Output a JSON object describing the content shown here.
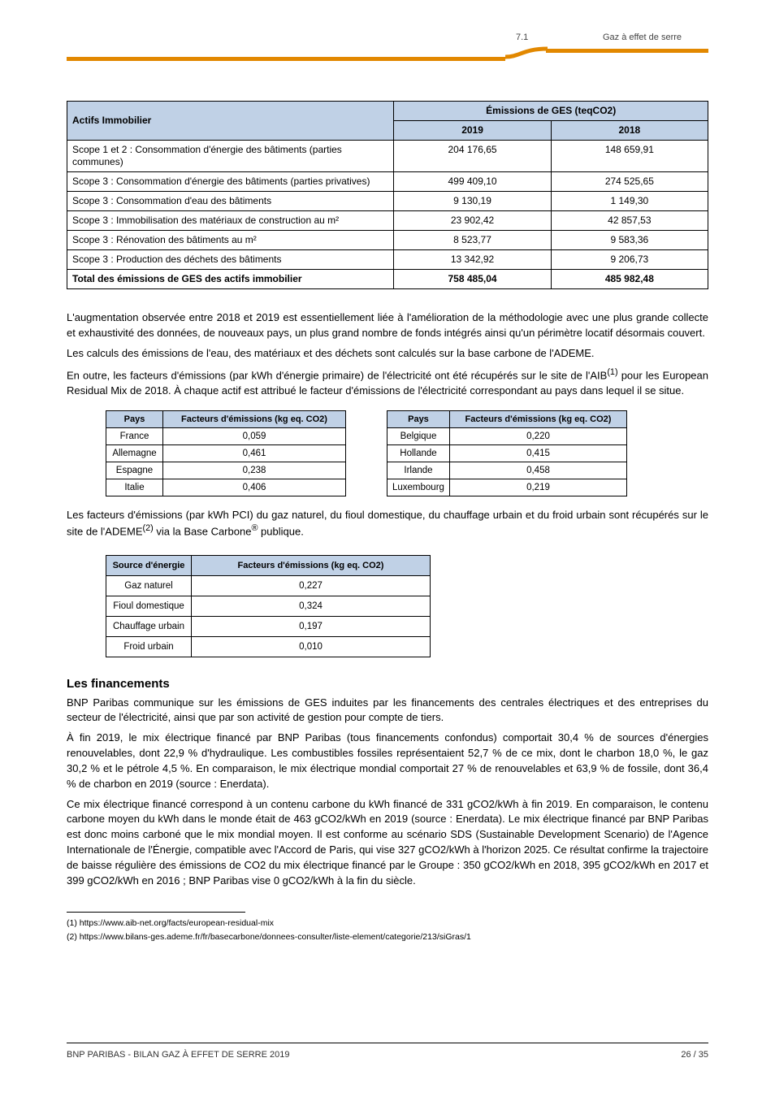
{
  "header": {
    "left": "7.1 ",
    "right": "Gaz à effet de serre"
  },
  "chart_data": [
    {
      "type": "table",
      "title": "Émissions de GES — Actifs Immobilier",
      "header": {
        "actifs": "Actifs Immobilier",
        "emissions": "Émissions de GES (teqCO2)",
        "y2019": "2019",
        "y2018": "2018"
      },
      "rows": [
        {
          "label": "Scope 1 et 2 : Consommation d'énergie des bâtiments (parties communes)",
          "y2019": "204 176,65",
          "y2018": "148 659,91"
        },
        {
          "label": "Scope 3 : Consommation d'énergie des bâtiments (parties privatives)",
          "y2019": "499 409,10",
          "y2018": "274 525,65"
        },
        {
          "label": "Scope 3 : Consommation d'eau des bâtiments",
          "y2019": "9 130,19",
          "y2018": "1 149,30"
        },
        {
          "label": "Scope 3 : Immobilisation des matériaux de construction au m²",
          "y2019": "23 902,42",
          "y2018": "42 857,53"
        },
        {
          "label": "Scope 3 : Rénovation des bâtiments au m²",
          "y2019": "8 523,77",
          "y2018": "9 583,36"
        },
        {
          "label": "Scope 3 : Production des déchets des bâtiments",
          "y2019": "13 342,92",
          "y2018": "9 206,73"
        },
        {
          "label": "Total des émissions de GES des actifs immobilier",
          "bold": true,
          "y2019": "758 485,04",
          "y2018": "485 982,48"
        }
      ]
    },
    {
      "type": "table",
      "title": "Facteurs d'émissions par pays (kg eq. CO2)",
      "groups": [
        {
          "header": {
            "c1": "Pays",
            "c2": "Facteurs d'émissions (kg eq. CO2)"
          },
          "rows": [
            {
              "c1": "France",
              "c2": "0,059"
            },
            {
              "c1": "Allemagne",
              "c2": "0,461"
            },
            {
              "c1": "Espagne",
              "c2": "0,238"
            },
            {
              "c1": "Italie",
              "c2": "0,406"
            }
          ]
        },
        {
          "header": {
            "c1": "Pays",
            "c2": "Facteurs d'émissions (kg eq. CO2)"
          },
          "rows": [
            {
              "c1": "Belgique",
              "c2": "0,220"
            },
            {
              "c1": "Hollande",
              "c2": "0,415"
            },
            {
              "c1": "Irlande",
              "c2": "0,458"
            },
            {
              "c1": "Luxembourg",
              "c2": "0,219"
            }
          ]
        }
      ]
    },
    {
      "type": "table",
      "title": "Facteurs d'émissions par source d'énergie",
      "header": {
        "c1": "Source d'énergie",
        "c2": "Facteurs d'émissions (kg eq. CO2)"
      },
      "rows": [
        {
          "c1": "Gaz naturel",
          "c2": "0,227"
        },
        {
          "c1": "Fioul domestique",
          "c2": "0,324"
        },
        {
          "c1": "Chauffage urbain",
          "c2": "0,197"
        },
        {
          "c1": "Froid urbain",
          "c2": "0,010"
        }
      ]
    }
  ],
  "section": {
    "title": "Les financements"
  },
  "paras": {
    "p0": "L'augmentation observée entre 2018 et 2019 est essentiellement liée à l'amélioration de la méthodologie avec une plus grande collecte et exhaustivité des données, de nouveaux pays, un plus grand nombre de fonds intégrés ainsi qu'un périmètre locatif désormais couvert.",
    "p1": "Les calculs des émissions de l'eau, des matériaux et des déchets sont calculés sur la base carbone de l'ADEME.",
    "p2a": "En outre, les facteurs d'émissions (par kWh d'énergie primaire) de l'électricité ont été récupérés sur le site de l'AIB",
    "p2sup": "(1)",
    "p2b": " pour les European Residual Mix de 2018. À chaque actif est attribué le facteur d'émissions de l'électricité correspondant au pays dans lequel il se situe.",
    "p3a": "Les facteurs d'émissions (par kWh PCI) du gaz naturel, du fioul domestique, du chauffage urbain et du froid urbain sont récupérés sur le site de l'ADEME",
    "p3sup": "(2)",
    "p3b": " via la Base Carbone",
    "p3sup2": "®",
    "p3c": " publique.",
    "p4": "BNP Paribas communique sur les émissions de GES induites par les financements des centrales électriques et des entreprises du secteur de l'électricité, ainsi que par son activité de gestion pour compte de tiers.",
    "p5": "À fin 2019, le mix électrique financé par BNP Paribas (tous financements confondus) comportait 30,4 % de sources d'énergies renouvelables, dont 22,9 % d'hydraulique. Les combustibles fossiles représentaient 52,7 % de ce mix, dont le charbon 18,0 %, le gaz 30,2 % et le pétrole 4,5 %. En comparaison, le mix électrique mondial comportait 27 % de renouvelables et 63,9 % de fossile, dont 36,4 % de charbon en 2019 (source : Enerdata).",
    "p6": "Ce mix électrique financé correspond à un contenu carbone du kWh financé de 331 gCO2/kWh à fin 2019. En comparaison, le contenu carbone moyen du kWh dans le monde était de 463 gCO2/kWh en 2019 (source : Enerdata). Le mix électrique financé par BNP Paribas est donc moins carboné que le mix mondial moyen. Il est conforme au scénario SDS (Sustainable Development Scenario) de l'Agence Internationale de l'Énergie, compatible avec l'Accord de Paris, qui vise 327 gCO2/kWh à l'horizon 2025. Ce résultat confirme la trajectoire de baisse régulière des émissions de CO2 du mix électrique financé par le Groupe : 350 gCO2/kWh en 2018, 395 gCO2/kWh en 2017 et 399 gCO2/kWh en 2016 ; BNP Paribas vise 0 gCO2/kWh à la fin du siècle."
  },
  "footnotes": {
    "f1": "(1) https://www.aib-net.org/facts/european-residual-mix",
    "f2": "(2) https://www.bilans-ges.ademe.fr/fr/basecarbone/donnees-consulter/liste-element/categorie/213/siGras/1"
  },
  "footer": {
    "left": "BNP PARIBAS - BILAN GAZ À EFFET DE SERRE 2019",
    "right": "26 / 35"
  }
}
